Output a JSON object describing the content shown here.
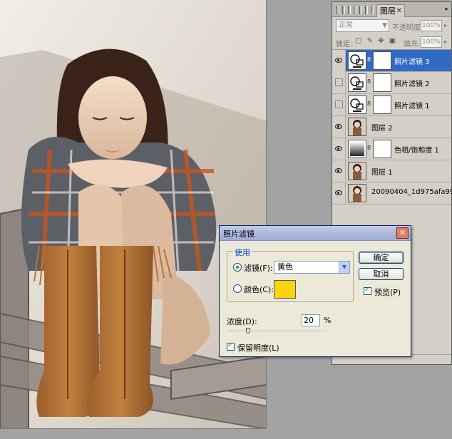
{
  "layers_panel": {
    "tab_label": "图层",
    "tab_close": "✕",
    "menu_arrow": "▸",
    "blend_mode": "正常",
    "opacity_label": "不透明度:",
    "opacity_value": "100%",
    "lock_label": "锁定:",
    "lock_icons": "▢ ✎ ✥ ▣",
    "fill_label": "填充:",
    "fill_value": "100%",
    "layers": [
      {
        "name": "照片滤镜 3",
        "type": "adjustment",
        "visible": true,
        "selected": true
      },
      {
        "name": "照片滤镜 2",
        "type": "adjustment",
        "visible": false,
        "selected": false
      },
      {
        "name": "照片滤镜 1",
        "type": "adjustment",
        "visible": false,
        "selected": false
      },
      {
        "name": "图层 2",
        "type": "photo",
        "visible": true,
        "selected": false
      },
      {
        "name": "色相/饱和度 1",
        "type": "adjustment-gradient",
        "visible": true,
        "selected": false
      },
      {
        "name": "图层 1",
        "type": "photo",
        "visible": true,
        "selected": false
      },
      {
        "name": "20090404_1d975afa99...",
        "type": "photo",
        "visible": true,
        "selected": false
      }
    ]
  },
  "dialog": {
    "title": "照片滤镜",
    "close": "✕",
    "group_title": "使用",
    "filter_label": "滤镜(F):",
    "filter_value": "黄色",
    "color_label": "颜色(C):",
    "swatch_color": "#f9d40e",
    "ok_label": "确定",
    "cancel_label": "取消",
    "preview_label": "预览(P)",
    "preview_checked": true,
    "density_label": "浓度(D):",
    "density_value": "20",
    "density_unit": "%",
    "density_fraction": 0.2,
    "preserve_label": "保留明度(L)",
    "preserve_checked": true
  }
}
